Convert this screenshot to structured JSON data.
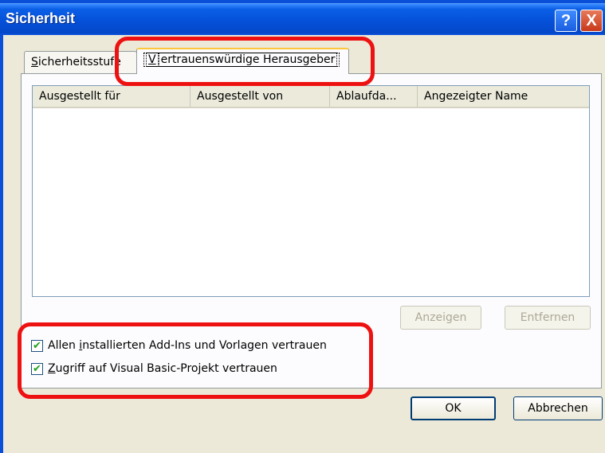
{
  "window": {
    "title": "Sicherheit",
    "help_glyph": "?",
    "close_glyph": "X"
  },
  "tabs": [
    {
      "label_pre": "S",
      "label_rest": "icherheitsstufe",
      "active": false
    },
    {
      "label_pre": "V",
      "label_rest": "ertrauenswürdige Herausgeber",
      "active": true
    }
  ],
  "list": {
    "columns": [
      "Ausgestellt für",
      "Ausgestellt von",
      "Ablaufda...",
      "Angezeigter Name"
    ],
    "rows": []
  },
  "buttons": {
    "show": "Anzeigen",
    "remove": "Entfernen",
    "ok": "OK",
    "cancel": "Abbrechen"
  },
  "checkboxes": [
    {
      "pre": "Allen ",
      "ul": "i",
      "rest": "nstallierten Add-Ins und Vorlagen vertrauen",
      "checked": true
    },
    {
      "pre": "",
      "ul": "Z",
      "rest": "ugriff auf Visual Basic-Projekt vertrauen",
      "checked": true
    }
  ],
  "colors": {
    "titlebar": "#0550d8",
    "dialog_bg": "#ece9d8",
    "highlight": "#ee1111",
    "check": "#21a121"
  }
}
